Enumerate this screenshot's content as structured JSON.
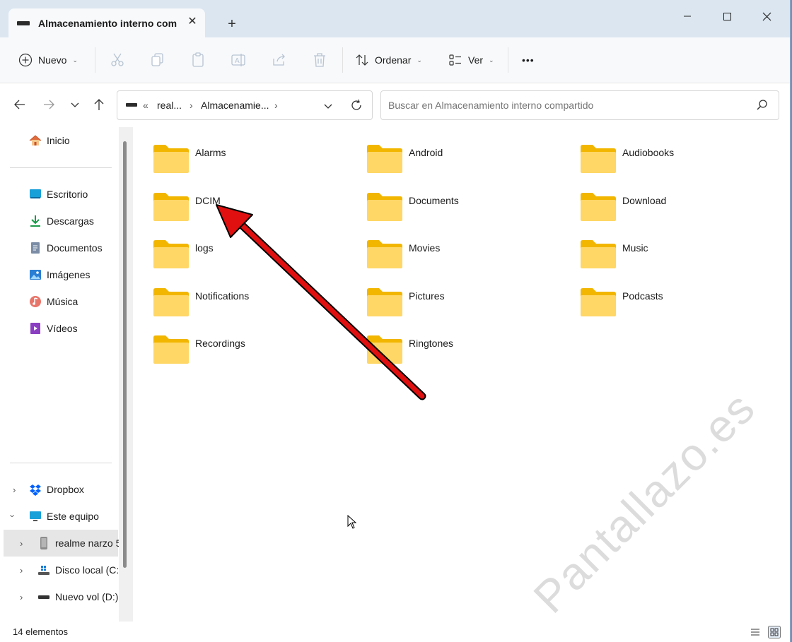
{
  "titlebar": {
    "tab_title": "Almacenamiento interno com",
    "tab_close": "✕",
    "new_tab": "+"
  },
  "toolbar": {
    "new_label": "Nuevo",
    "sort_label": "Ordenar",
    "view_label": "Ver",
    "more_label": "•••"
  },
  "address": {
    "prefix": "«",
    "crumb1": "real...",
    "sep1": "›",
    "crumb2": "Almacenamie...",
    "sep2": "›"
  },
  "search": {
    "placeholder": "Buscar en Almacenamiento interno compartido"
  },
  "sidebar": {
    "home": "Inicio",
    "quick": [
      {
        "label": "Escritorio",
        "icon": "desktop-icon"
      },
      {
        "label": "Descargas",
        "icon": "download-icon"
      },
      {
        "label": "Documentos",
        "icon": "document-icon"
      },
      {
        "label": "Imágenes",
        "icon": "image-icon"
      },
      {
        "label": "Música",
        "icon": "music-icon"
      },
      {
        "label": "Vídeos",
        "icon": "video-icon"
      }
    ],
    "tree": [
      {
        "label": "Dropbox"
      },
      {
        "label": "Este equipo"
      },
      {
        "label": "realme narzo 5"
      },
      {
        "label": "Disco local (C:)"
      },
      {
        "label": "Nuevo vol (D:)"
      }
    ]
  },
  "folders": [
    "Alarms",
    "Android",
    "Audiobooks",
    "DCIM",
    "Documents",
    "Download",
    "logs",
    "Movies",
    "Music",
    "Notifications",
    "Pictures",
    "Podcasts",
    "Recordings",
    "Ringtones"
  ],
  "status": {
    "count": "14 elementos"
  },
  "watermark": "Pantallazo.es",
  "colors": {
    "folder": "#ffd766",
    "folder_dark": "#f2b600",
    "accent": "#0067c0",
    "arrow": "#e01010"
  }
}
